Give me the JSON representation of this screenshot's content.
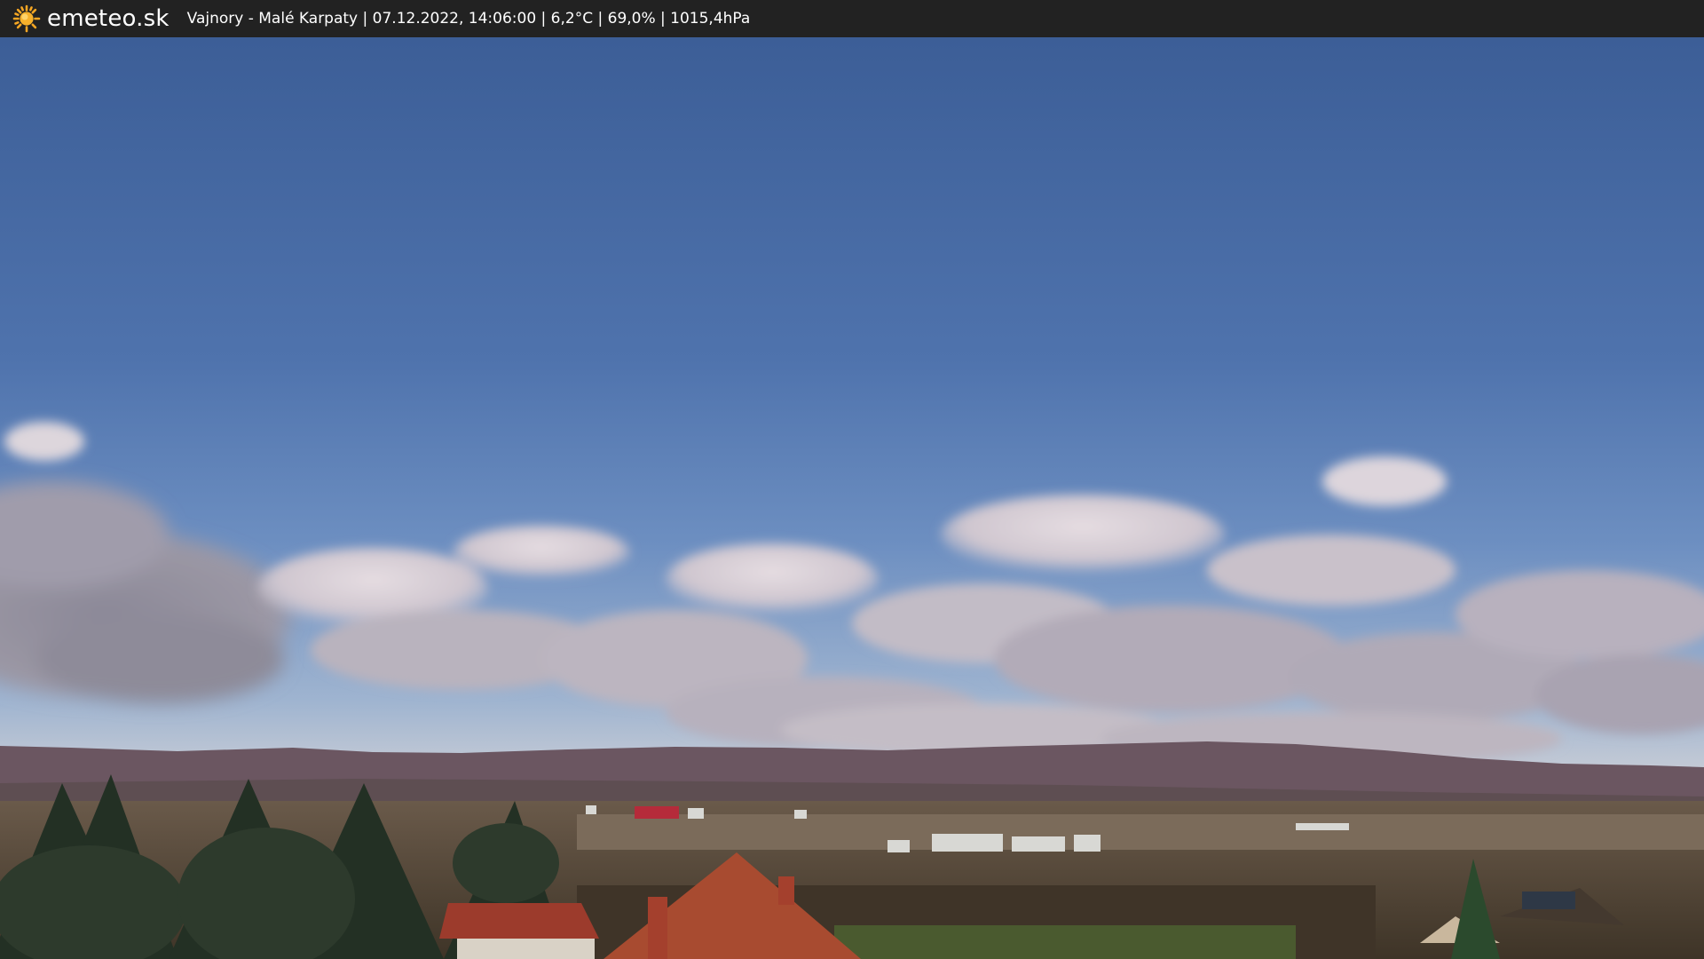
{
  "header": {
    "logo_icon": "sun-icon",
    "brand": "emeteo.sk",
    "caption": "Vajnory - Malé Karpaty | 07.12.2022, 14:06:00 | 6,2°C | 69,0% | 1015,4hPa"
  },
  "colors": {
    "bar_bg": "#222222",
    "sun": "#f5a623",
    "sky_top": "#3c5f98",
    "sky_bottom": "#a9bcd3"
  }
}
